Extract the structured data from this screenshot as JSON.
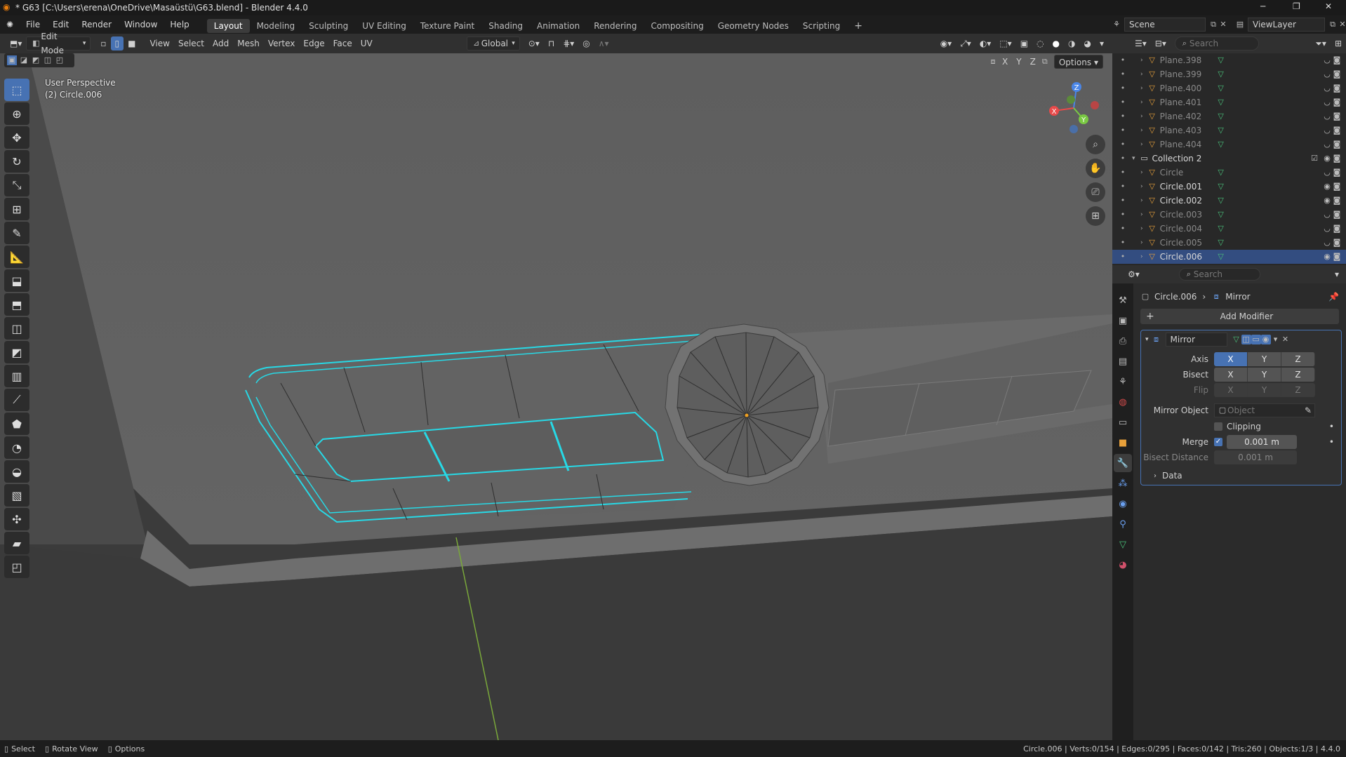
{
  "titlebar": {
    "title": "* G63 [C:\\Users\\erena\\OneDrive\\Masaüstü\\G63.blend] - Blender 4.4.0"
  },
  "menu": [
    "File",
    "Edit",
    "Render",
    "Window",
    "Help"
  ],
  "workspaces": [
    "Layout",
    "Modeling",
    "Sculpting",
    "UV Editing",
    "Texture Paint",
    "Shading",
    "Animation",
    "Rendering",
    "Compositing",
    "Geometry Nodes",
    "Scripting"
  ],
  "workspace_active": "Layout",
  "scene": {
    "label": "Scene",
    "viewlayer": "ViewLayer"
  },
  "viewport_header": {
    "mode": "Edit Mode",
    "menus": [
      "View",
      "Select",
      "Add",
      "Mesh",
      "Vertex",
      "Edge",
      "Face",
      "UV"
    ],
    "transform": "Global",
    "options": "Options",
    "axes": [
      "X",
      "Y",
      "Z"
    ]
  },
  "viewport_overlay": {
    "line1": "User Perspective",
    "line2": "(2) Circle.006"
  },
  "gizmo": {
    "x": "X",
    "y": "Y",
    "z": "Z"
  },
  "outliner": {
    "search_placeholder": "Search",
    "rows": [
      {
        "name": "Plane.398",
        "dim": true
      },
      {
        "name": "Plane.399",
        "dim": true
      },
      {
        "name": "Plane.400",
        "dim": true
      },
      {
        "name": "Plane.401",
        "dim": true
      },
      {
        "name": "Plane.402",
        "dim": true
      },
      {
        "name": "Plane.403",
        "dim": true
      },
      {
        "name": "Plane.404",
        "dim": true
      },
      {
        "name": "Collection 2",
        "dim": false,
        "collection": true
      },
      {
        "name": "Circle",
        "dim": true
      },
      {
        "name": "Circle.001",
        "dim": false
      },
      {
        "name": "Circle.002",
        "dim": false
      },
      {
        "name": "Circle.003",
        "dim": true
      },
      {
        "name": "Circle.004",
        "dim": true
      },
      {
        "name": "Circle.005",
        "dim": true
      },
      {
        "name": "Circle.006",
        "dim": false,
        "selected": true
      }
    ]
  },
  "properties": {
    "search_placeholder": "Search",
    "breadcrumb_object": "Circle.006",
    "breadcrumb_modifier": "Mirror",
    "add_modifier": "Add Modifier",
    "modifier_name": "Mirror",
    "axis_label": "Axis",
    "bisect_label": "Bisect",
    "flip_label": "Flip",
    "axes": [
      "X",
      "Y",
      "Z"
    ],
    "mirror_object_label": "Mirror Object",
    "mirror_object_placeholder": "Object",
    "clipping_label": "Clipping",
    "merge_label": "Merge",
    "merge_value": "0.001 m",
    "bisect_distance_label": "Bisect Distance",
    "bisect_distance_value": "0.001 m",
    "data_label": "Data"
  },
  "statusbar": {
    "select": "Select",
    "rotate": "Rotate View",
    "options": "Options",
    "stats": "Circle.006 | Verts:0/154 | Edges:0/295 | Faces:0/142 | Tris:260 | Objects:1/3 | 4.4.0"
  },
  "colors": {
    "accent": "#4772b3",
    "wire_select": "#27d9e6",
    "viewport_bg": "#5b5b5b"
  }
}
